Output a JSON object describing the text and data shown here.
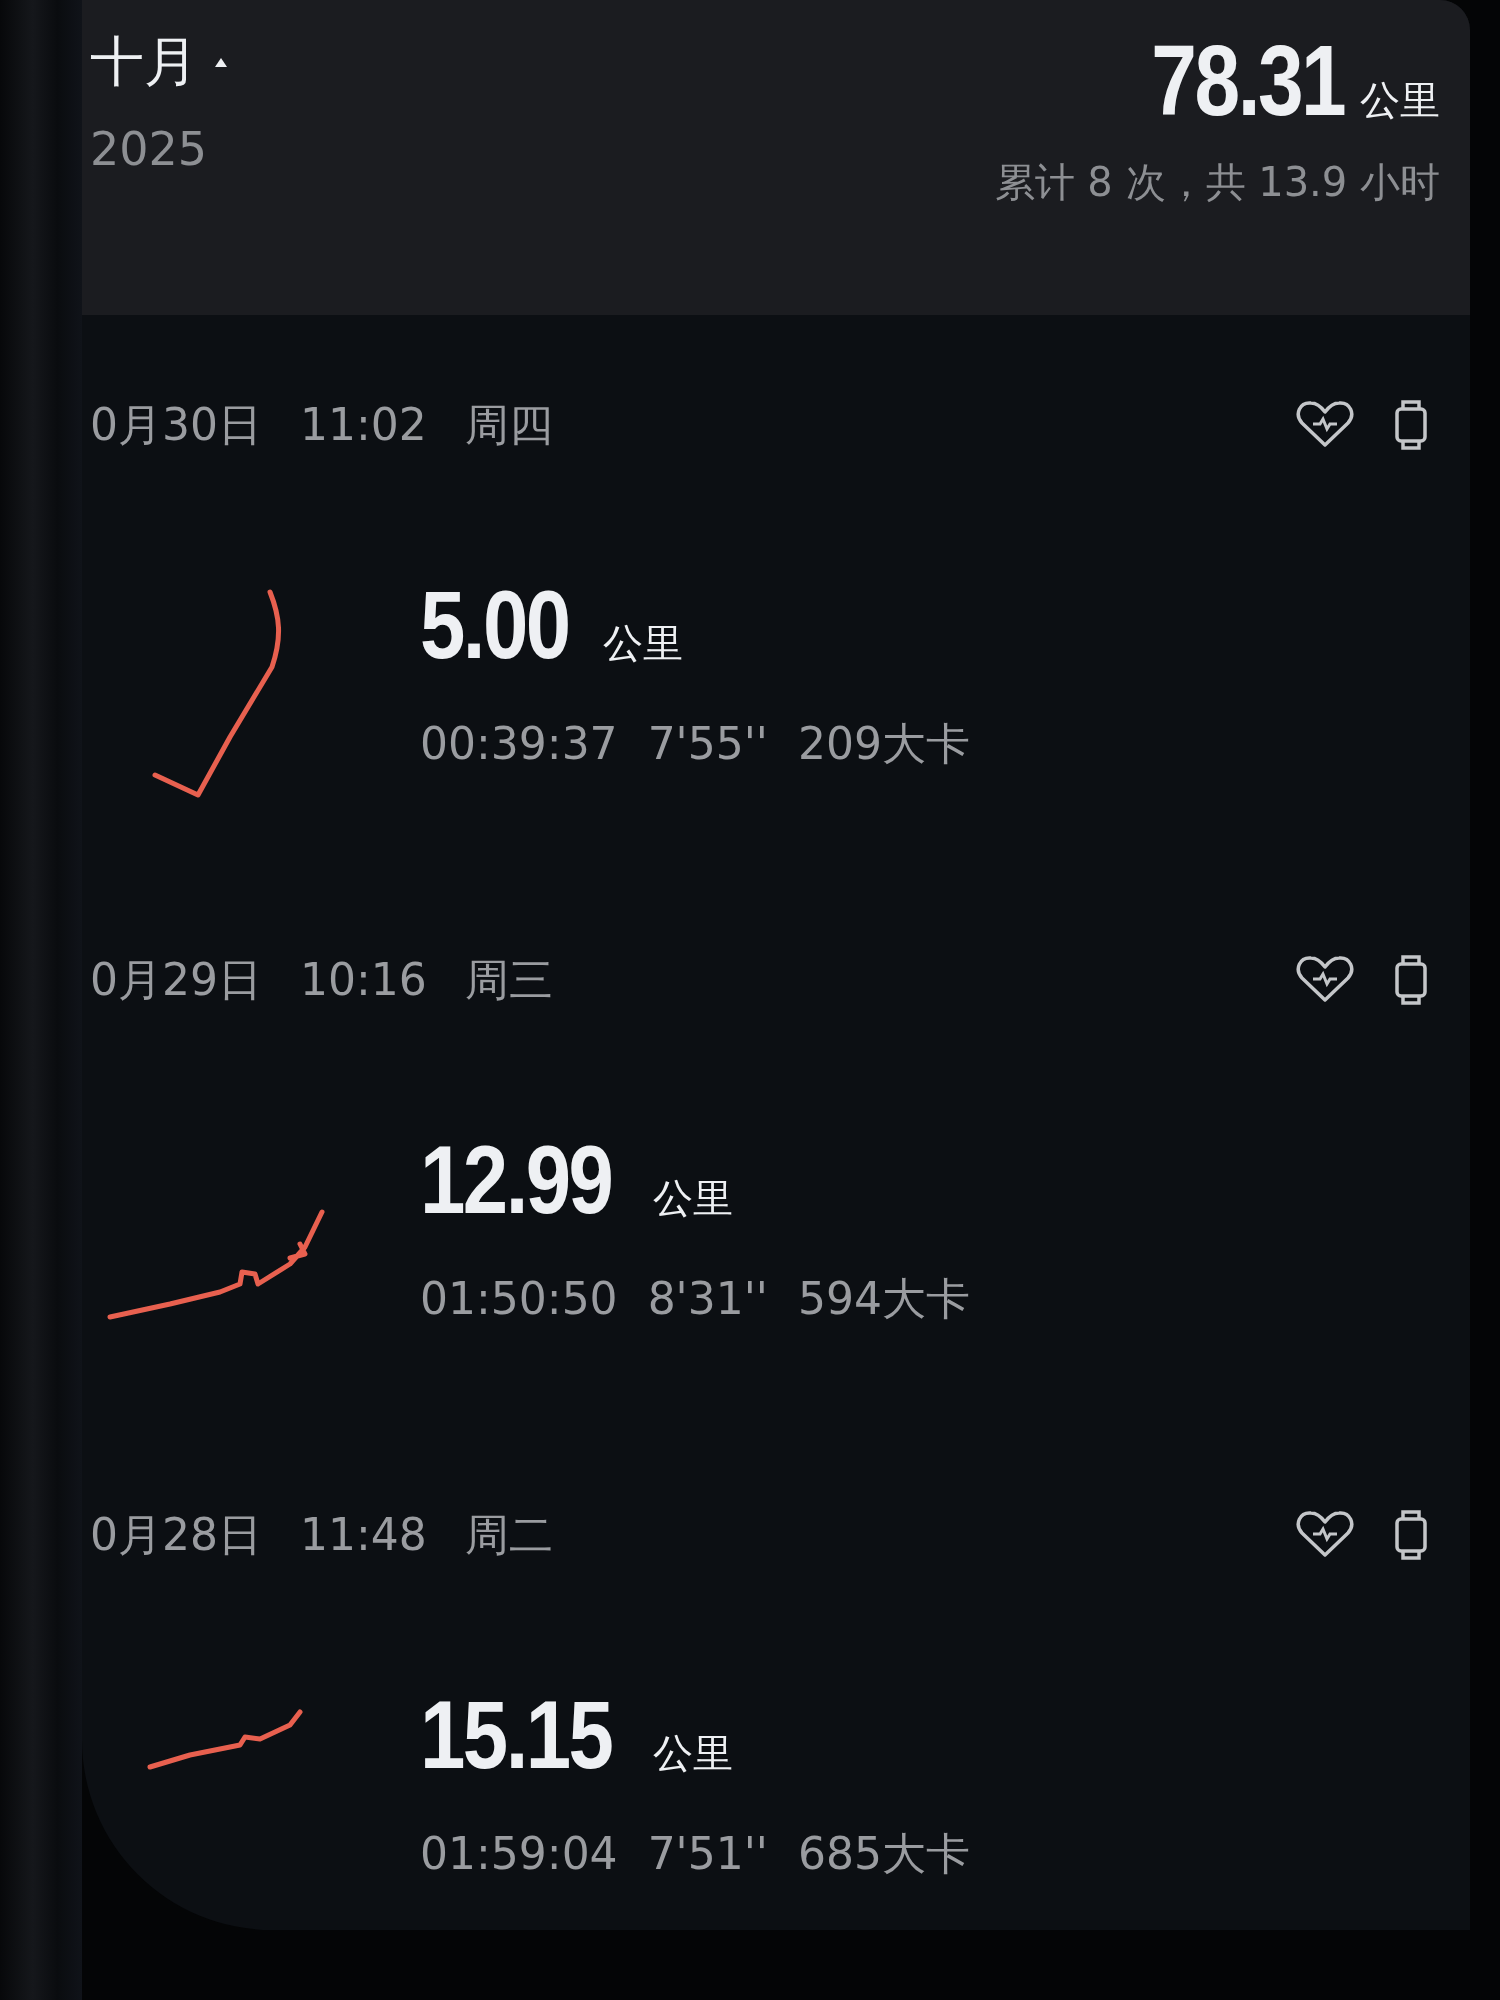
{
  "header": {
    "month": "十月",
    "year": "2025",
    "total_distance": "78.31",
    "total_unit": "公里",
    "summary": "累计 8 次，共 13.9 小时"
  },
  "activities": [
    {
      "date": "0月30日",
      "time": "11:02",
      "weekday": "周四",
      "distance": "5.00",
      "unit": "公里",
      "duration": "00:39:37",
      "pace": "7'55''",
      "calories": "209大卡"
    },
    {
      "date": "0月29日",
      "time": "10:16",
      "weekday": "周三",
      "distance": "12.99",
      "unit": "公里",
      "duration": "01:50:50",
      "pace": "8'31''",
      "calories": "594大卡"
    },
    {
      "date": "0月28日",
      "time": "11:48",
      "weekday": "周二",
      "distance": "15.15",
      "unit": "公里",
      "duration": "01:59:04",
      "pace": "7'51''",
      "calories": "685大卡"
    }
  ]
}
